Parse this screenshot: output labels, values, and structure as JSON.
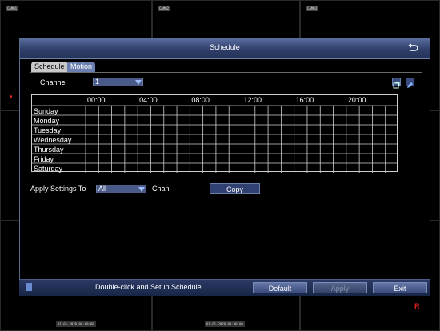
{
  "background": {
    "camera_labels": [
      "CAM01",
      "CAM02",
      "CAM03"
    ],
    "timestamps": [
      "01-01-2020 00:00:00",
      "01-01-2020 00:00:00"
    ]
  },
  "dialog": {
    "title": "Schedule",
    "tabs": [
      {
        "label": "Schedule",
        "active": true
      },
      {
        "label": "Motion",
        "active": false
      }
    ],
    "channel": {
      "label": "Channel",
      "value": "1"
    },
    "time_headers": [
      "00:00",
      "04:00",
      "08:00",
      "12:00",
      "16:00",
      "20:00"
    ],
    "days": [
      "Sunday",
      "Monday",
      "Tuesday",
      "Wednesday",
      "Thursday",
      "Friday",
      "Saturday"
    ],
    "apply": {
      "label": "Apply Settings To",
      "value": "All",
      "suffix": "Chan",
      "copy_label": "Copy"
    },
    "footer": {
      "hint": "Double-click and Setup Schedule",
      "default_label": "Default",
      "apply_label": "Apply",
      "exit_label": "Exit"
    },
    "colors": {
      "title_bar": "#3f5080",
      "accent": "#6a7fb0",
      "grid_line": "#cfcfcf"
    }
  }
}
